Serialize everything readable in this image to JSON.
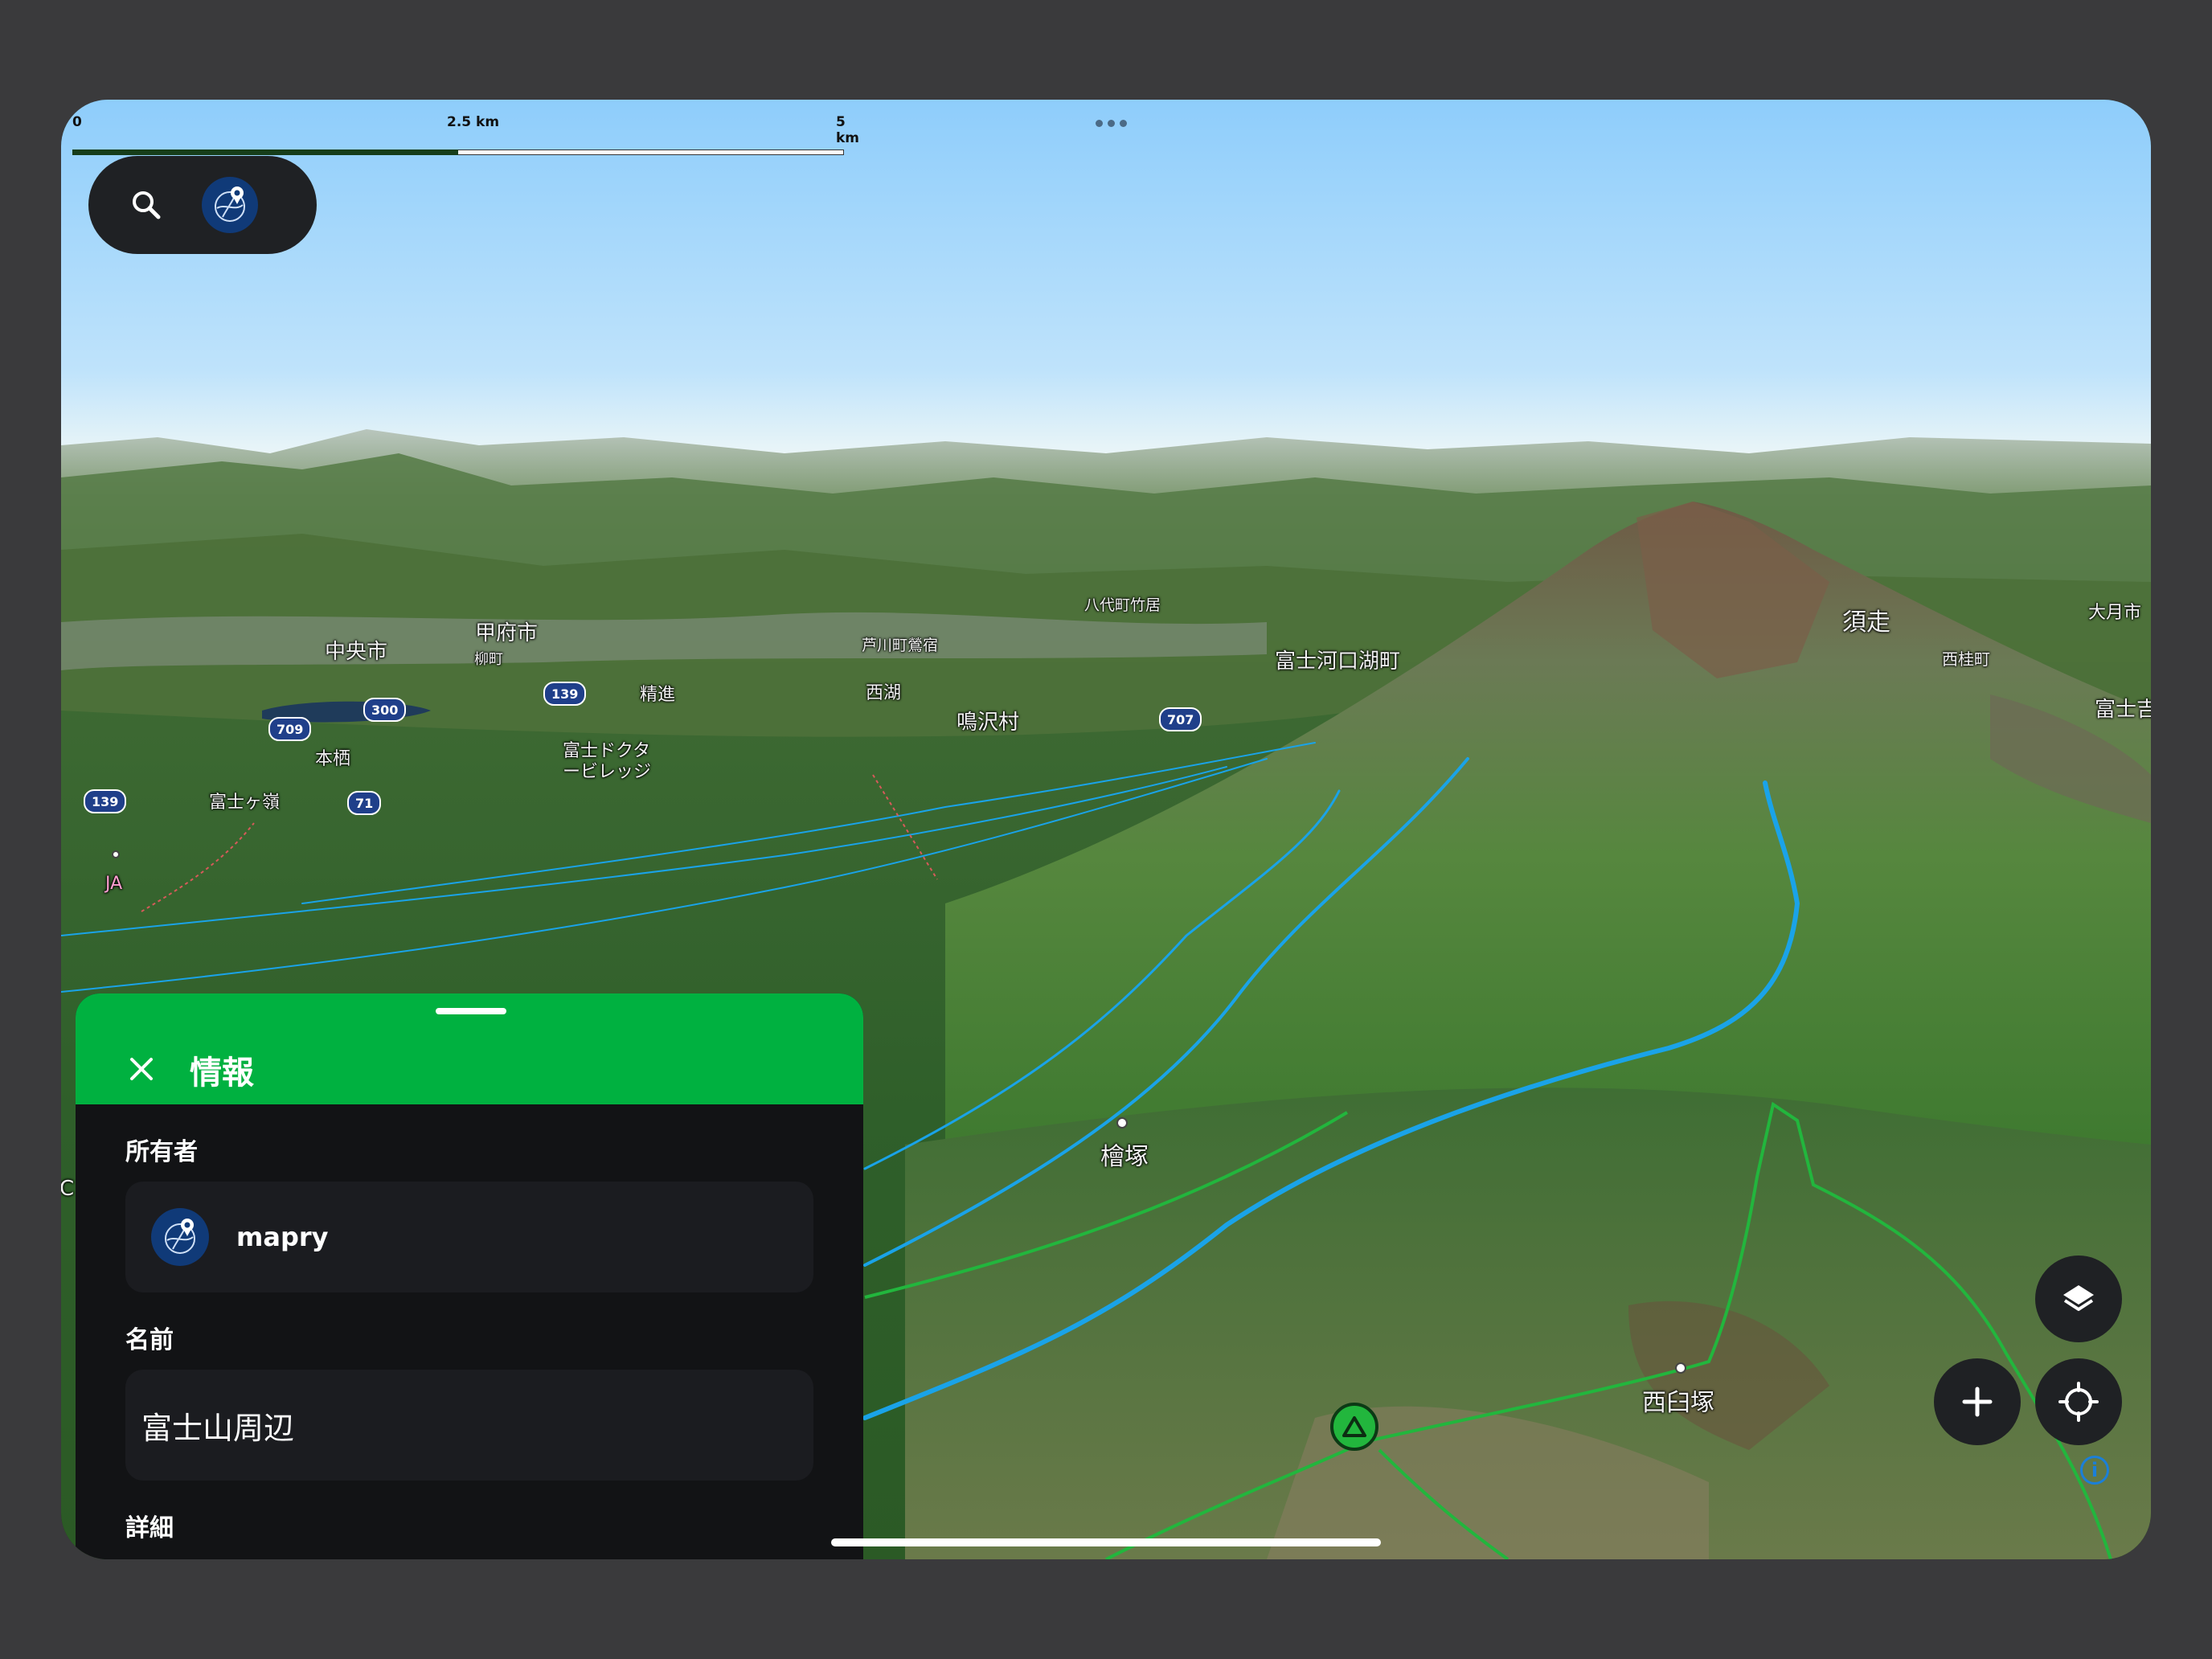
{
  "scale_bar": {
    "labels": [
      "0",
      "2.5 km",
      "5 km"
    ]
  },
  "toolbar": {
    "search_icon": "search-icon",
    "logo_icon": "mapry-logo-icon"
  },
  "map": {
    "place_labels": [
      {
        "text": "中央市"
      },
      {
        "text": "甲府市"
      },
      {
        "text": "柳町"
      },
      {
        "text": "精進"
      },
      {
        "text": "芦川町鶯宿"
      },
      {
        "text": "八代町竹居"
      },
      {
        "text": "西湖"
      },
      {
        "text": "鳴沢村"
      },
      {
        "text": "富士河口湖町"
      },
      {
        "text": "須走"
      },
      {
        "text": "大月市"
      },
      {
        "text": "西桂町"
      },
      {
        "text": "富士吉"
      },
      {
        "text": "本栖"
      },
      {
        "text": "富士ドクタ"
      },
      {
        "text": "ービレッジ"
      },
      {
        "text": "富士ヶ嶺"
      },
      {
        "text": "JA"
      },
      {
        "text": "檜塚"
      },
      {
        "text": "西臼塚"
      },
      {
        "text": "C"
      }
    ],
    "road_shields": [
      {
        "text": "139"
      },
      {
        "text": "300"
      },
      {
        "text": "709"
      },
      {
        "text": "707"
      },
      {
        "text": "71"
      },
      {
        "text": "139"
      }
    ]
  },
  "controls": {
    "layers_icon": "layers-icon",
    "add_icon": "plus-icon",
    "locate_icon": "crosshair-icon",
    "info_icon": "info-icon",
    "info_glyph": "i"
  },
  "sheet": {
    "title": "情報",
    "owner_label": "所有者",
    "owner_name": "mapry",
    "name_label": "名前",
    "name_value": "富士山周辺",
    "details_label": "詳細"
  },
  "colors": {
    "sheet_header": "#00b140",
    "sheet_body": "#121315",
    "river": "#1aa3e8",
    "trail": "#22b63d"
  }
}
